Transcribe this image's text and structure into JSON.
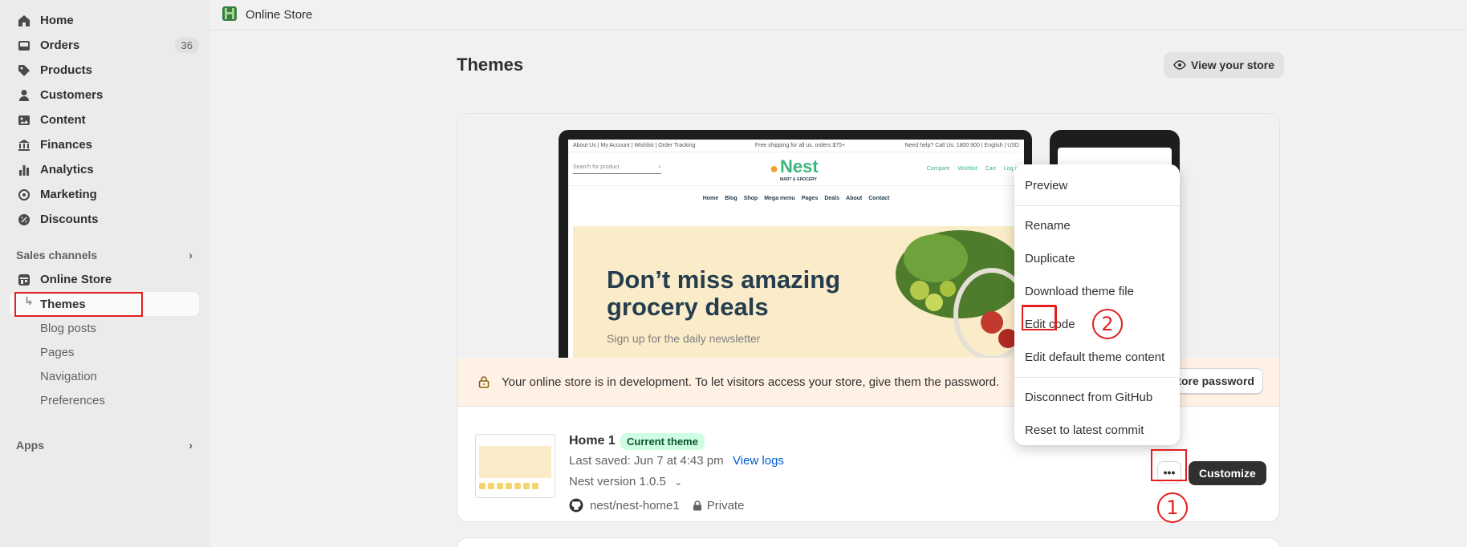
{
  "sidebar": {
    "items": [
      {
        "label": "Home",
        "icon": "home-icon"
      },
      {
        "label": "Orders",
        "icon": "orders-icon",
        "count": "36"
      },
      {
        "label": "Products",
        "icon": "tag-icon"
      },
      {
        "label": "Customers",
        "icon": "person-icon"
      },
      {
        "label": "Content",
        "icon": "content-icon"
      },
      {
        "label": "Finances",
        "icon": "bank-icon"
      },
      {
        "label": "Analytics",
        "icon": "bar-chart-icon"
      },
      {
        "label": "Marketing",
        "icon": "target-icon"
      },
      {
        "label": "Discounts",
        "icon": "discount-icon"
      }
    ],
    "sales_channels_label": "Sales channels",
    "online_store_label": "Online Store",
    "sub_items": [
      "Themes",
      "Blog posts",
      "Pages",
      "Navigation",
      "Preferences"
    ],
    "apps_label": "Apps"
  },
  "topbar": {
    "title": "Online Store"
  },
  "page": {
    "title": "Themes",
    "view_store_label": "View your store"
  },
  "preview": {
    "top_links": "About Us | My Account | Wishlist | Order Tracking",
    "promo": "Free shipping for all us. orders $75+",
    "help": "Need help? Call Us: 1800 900  |  English  |  USD",
    "search_placeholder": "Search for product",
    "logo": "Nest",
    "logo_sub": "MART & GROCERY",
    "actions": [
      "Compare",
      "Wishlist",
      "Cart",
      "Log in"
    ],
    "nav": [
      "Home",
      "Blog",
      "Shop",
      "Mega menu",
      "Pages",
      "Deals",
      "About",
      "Contact"
    ],
    "hero_line1": "Don’t miss amazing",
    "hero_line2": "grocery deals",
    "hero_sub": "Sign up for the daily newsletter"
  },
  "dev_banner": {
    "text": "Your online store is in development. To let visitors access your store, give them the password.",
    "button_label": "tore password"
  },
  "theme": {
    "name": "Home 1",
    "badge": "Current theme",
    "last_saved": "Last saved: Jun 7 at 4:43 pm",
    "view_logs": "View logs",
    "version": "Nest version 1.0.5",
    "repo": "nest/nest-home1",
    "visibility": "Private",
    "more_label": "•••",
    "customize_label": "Customize"
  },
  "menu": {
    "group1": [
      "Preview"
    ],
    "group2": [
      "Rename",
      "Duplicate",
      "Download theme file",
      "Edit code",
      "Edit default theme content"
    ],
    "group3": [
      "Disconnect from GitHub",
      "Reset to latest commit"
    ]
  },
  "annotations": {
    "step1": "1",
    "step2": "2"
  },
  "colors": {
    "annotation": "#e21f1f",
    "accent_link": "#005bd3",
    "badge_bg": "#cdfee1"
  }
}
